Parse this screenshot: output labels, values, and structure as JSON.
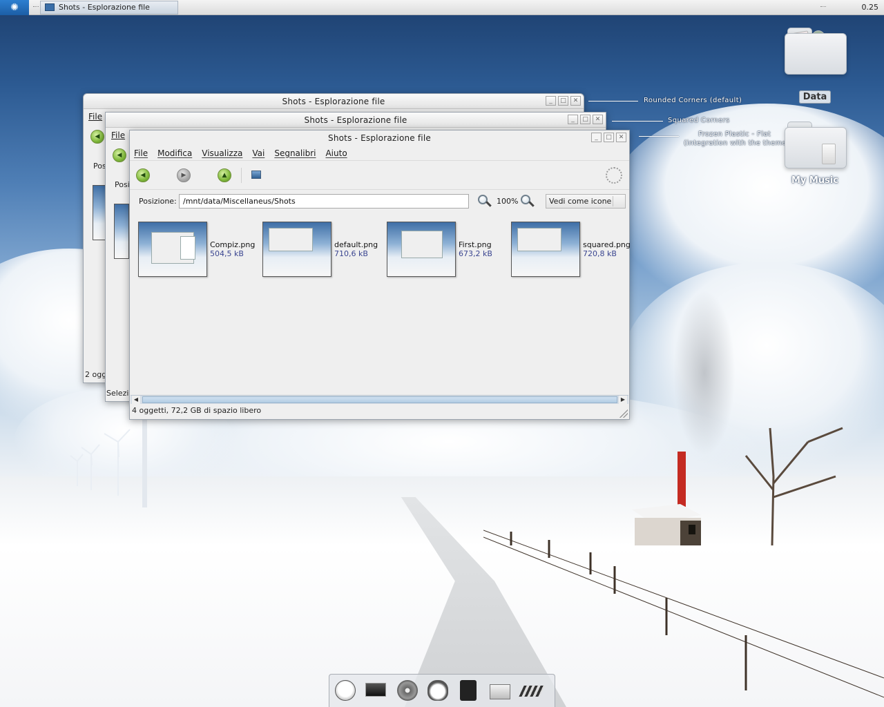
{
  "panel": {
    "task_title": "Shots - Esplorazione file",
    "clock": "0.25"
  },
  "windows": {
    "back": {
      "title": "Shots - Esplorazione file",
      "menu_file": "File",
      "location_label": "Pos",
      "status": "2 ogge"
    },
    "middle": {
      "title": "Shots - Esplorazione file",
      "menu_file": "File",
      "location_label": "Posi",
      "status": "Selezio"
    },
    "main": {
      "title": "Shots - Esplorazione file",
      "menu": [
        "File",
        "Modifica",
        "Visualizza",
        "Vai",
        "Segnalibri",
        "Aiuto"
      ],
      "location_label": "Posizione:",
      "location_value": "/mnt/data/Miscellaneus/Shots",
      "zoom": "100%",
      "view_mode": "Vedi come icone",
      "files": [
        {
          "name": "Compiz.png",
          "size": "504,5 kB"
        },
        {
          "name": "default.png",
          "size": "710,6 kB"
        },
        {
          "name": "First.png",
          "size": "673,2 kB"
        },
        {
          "name": "squared.png",
          "size": "720,8 kB"
        }
      ],
      "status": "4 oggetti, 72,2 GB di spazio libero"
    }
  },
  "annotations": {
    "rounded": "Rounded Corners (default)",
    "squared": "Squared Corners",
    "frozen_1": "Frozen Plastic - Flat",
    "frozen_2": "(integration with the theme)"
  },
  "desktop_icons": [
    {
      "label": "Data",
      "icon": "folder-icon"
    },
    {
      "label": "My Music",
      "icon": "folder-music-icon"
    }
  ],
  "dock": [
    "cow-icon",
    "monitor-icon",
    "cd-burner-icon",
    "penguin-icon",
    "speaker-icon",
    "printer-icon",
    "chess-board-icon"
  ]
}
